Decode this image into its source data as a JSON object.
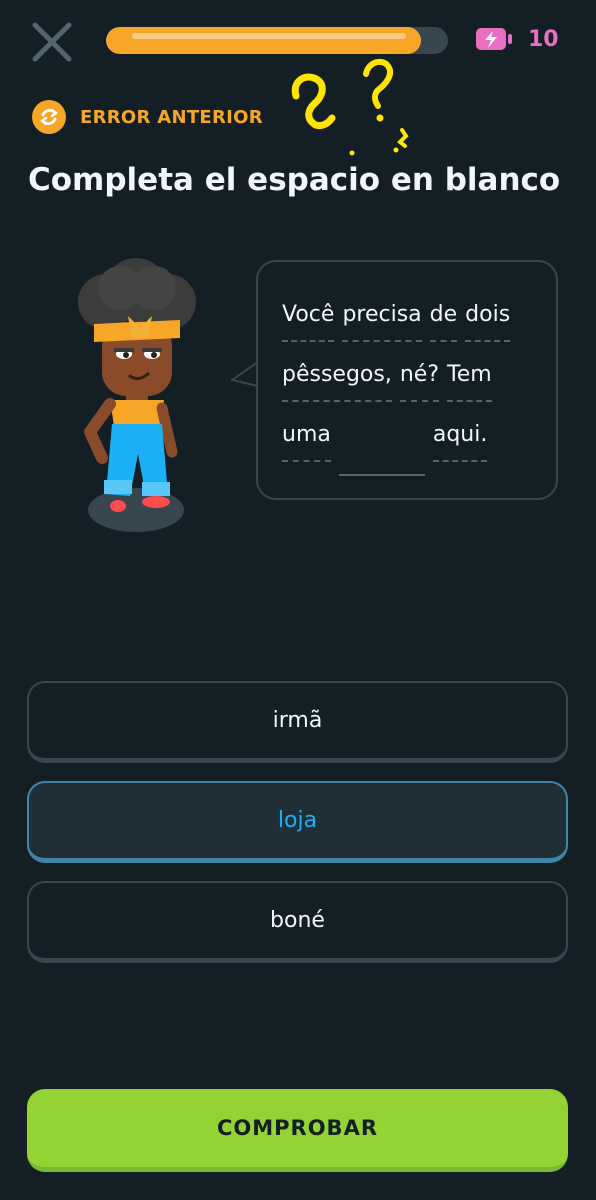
{
  "header": {
    "close_icon": "close-x-icon",
    "progress": 0.92,
    "energy_icon": "battery-bolt-icon",
    "energy_count": "10"
  },
  "prompt": {
    "previous_error_icon": "refresh-icon",
    "previous_error_label": "ERROR ANTERIOR",
    "title": "Completa el espacio en blanco"
  },
  "sentence": {
    "line1": [
      "Você",
      "precisa",
      "de",
      "dois"
    ],
    "line2": [
      "pêssegos,",
      "né?",
      "Tem"
    ],
    "line3_before": "uma",
    "line3_after": "aqui."
  },
  "options": [
    "irmã",
    "loja",
    "boné"
  ],
  "selected_option": "loja",
  "check_button": "COMPROBAR",
  "colors": {
    "background": "#131f24",
    "accent_orange": "#f7a628",
    "energy_pink": "#e96fc5",
    "selected_blue": "#1cb0f6",
    "check_green": "#93d333"
  }
}
